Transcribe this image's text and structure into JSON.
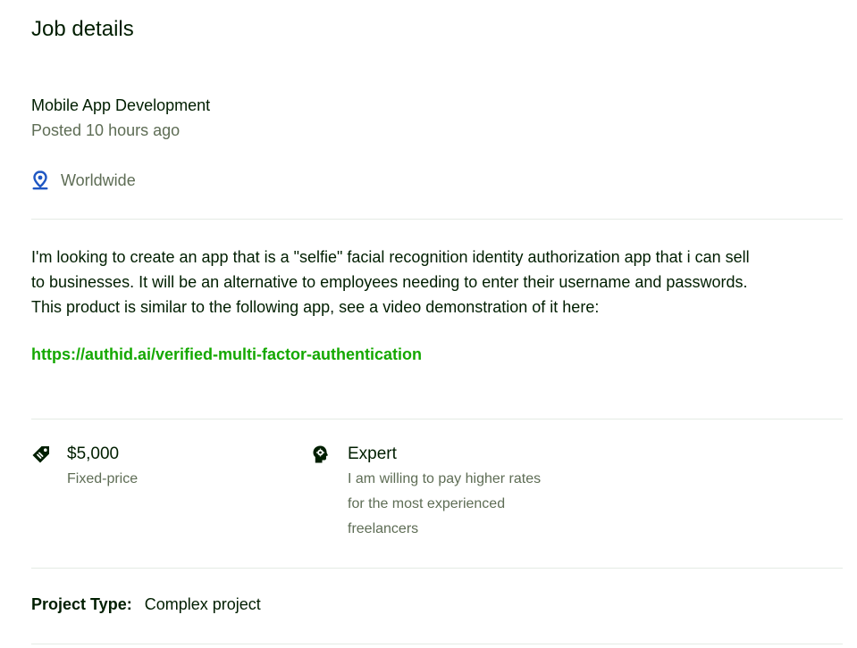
{
  "page": {
    "title": "Job details"
  },
  "job": {
    "title": "Mobile App Development",
    "posted": "Posted 10 hours ago",
    "location": "Worldwide",
    "description_lines": [
      "I'm looking to create an app that is a \"selfie\" facial recognition identity authorization app that i can sell",
      "to businesses. It will be an alternative to employees needing to enter their username and passwords.",
      "This product is similar to the following app, see a video demonstration of it here:"
    ],
    "link": "https://authid.ai/verified-multi-factor-authentication"
  },
  "features": {
    "price": {
      "value": "$5,000",
      "label": "Fixed-price",
      "icon": "price-tag-icon"
    },
    "level": {
      "value": "Expert",
      "description_lines": [
        "I am willing to pay higher rates",
        "for the most experienced",
        "freelancers"
      ],
      "icon": "expert-head-icon"
    }
  },
  "project": {
    "type_label": "Project Type:",
    "type_value": "Complex project"
  },
  "colors": {
    "link": "#14a800",
    "location_icon": "#1f57c3",
    "muted_text": "#5e6d55",
    "divider": "#e4ebe4"
  }
}
